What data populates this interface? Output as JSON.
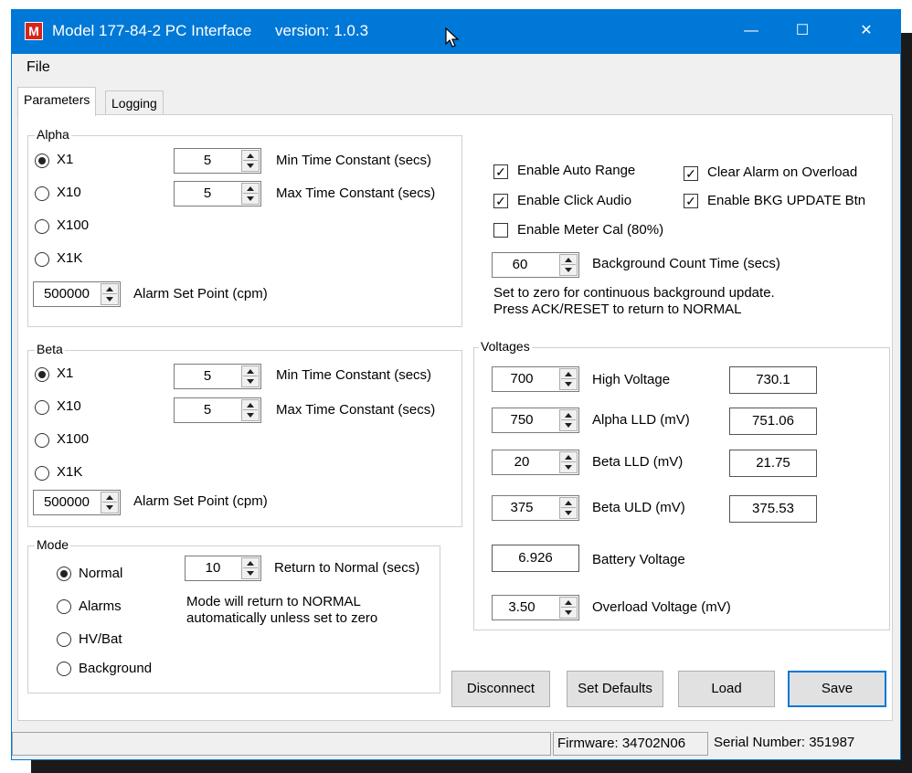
{
  "window": {
    "title": "Model 177-84-2 PC Interface",
    "version": "version: 1.0.3",
    "app_icon_letter": "M",
    "minimize_glyph": "—",
    "maximize_glyph": "☐",
    "close_glyph": "✕"
  },
  "menu": {
    "file": "File"
  },
  "tabs": [
    {
      "label": "Parameters"
    },
    {
      "label": "Logging"
    }
  ],
  "alpha": {
    "label": "Alpha",
    "ranges": [
      "X1",
      "X10",
      "X100",
      "X1K"
    ],
    "selected": "X1",
    "min_tc_value": "5",
    "min_tc_label": "Min Time Constant (secs)",
    "max_tc_value": "5",
    "max_tc_label": "Max Time Constant (secs)",
    "alarm_value": "500000",
    "alarm_label": "Alarm Set Point (cpm)"
  },
  "beta": {
    "label": "Beta",
    "ranges": [
      "X1",
      "X10",
      "X100",
      "X1K"
    ],
    "selected": "X1",
    "min_tc_value": "5",
    "min_tc_label": "Min Time Constant (secs)",
    "max_tc_value": "5",
    "max_tc_label": "Max Time Constant (secs)",
    "alarm_value": "500000",
    "alarm_label": "Alarm Set Point (cpm)"
  },
  "mode": {
    "label": "Mode",
    "options": [
      "Normal",
      "Alarms",
      "HV/Bat",
      "Background"
    ],
    "selected": "Normal",
    "return_value": "10",
    "return_label": "Return to Normal (secs)",
    "note_line1": "Mode will return to NORMAL",
    "note_line2": "automatically unless set to zero"
  },
  "options": {
    "auto_range": {
      "label": "Enable Auto Range",
      "checked": true
    },
    "clear_alarm": {
      "label": "Clear Alarm on Overload",
      "checked": true
    },
    "click_audio": {
      "label": "Enable Click Audio",
      "checked": true
    },
    "bkg_update": {
      "label": "Enable BKG UPDATE Btn",
      "checked": true
    },
    "meter_cal": {
      "label": "Enable Meter Cal (80%)",
      "checked": false
    },
    "bkg_count_value": "60",
    "bkg_count_label": "Background Count Time (secs)",
    "note_line1": "Set to zero for continuous background update.",
    "note_line2": "Press ACK/RESET to return to NORMAL"
  },
  "voltages": {
    "label": "Voltages",
    "hv": {
      "set": "700",
      "label": "High Voltage",
      "reading": "730.1"
    },
    "alpha_lld": {
      "set": "750",
      "label": "Alpha LLD (mV)",
      "reading": "751.06"
    },
    "beta_lld": {
      "set": "20",
      "label": "Beta LLD (mV)",
      "reading": "21.75"
    },
    "beta_uld": {
      "set": "375",
      "label": "Beta ULD (mV)",
      "reading": "375.53"
    },
    "battery": {
      "reading": "6.926",
      "label": "Battery Voltage"
    },
    "overload": {
      "set": "3.50",
      "label": "Overload Voltage (mV)"
    }
  },
  "buttons": {
    "disconnect": "Disconnect",
    "set_defaults": "Set Defaults",
    "load": "Load",
    "save": "Save"
  },
  "status": {
    "firmware": "Firmware: 34702N06",
    "serial": "Serial Number: 351987"
  }
}
